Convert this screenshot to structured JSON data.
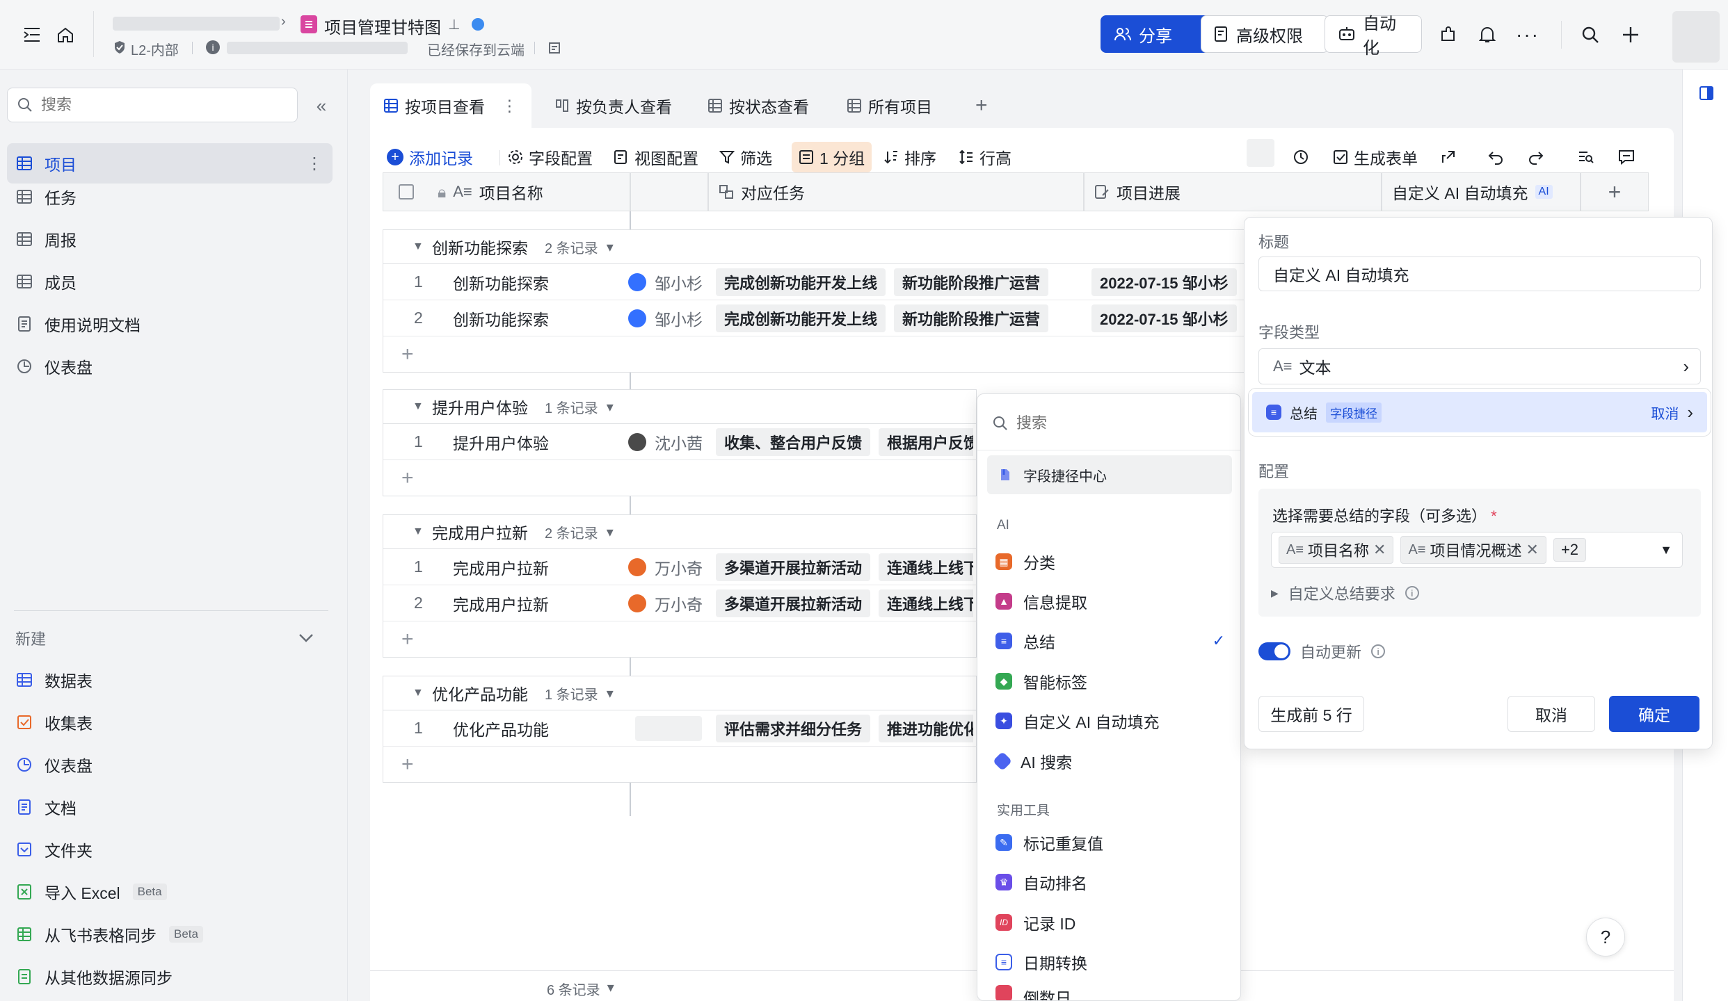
{
  "topbar": {
    "doc_title": "项目管理甘特图",
    "security_label": "L2-内部",
    "save_status": "已经保存到云端",
    "share_label": "分享",
    "advanced_perm_label": "高级权限",
    "automation_label": "自动化"
  },
  "sidebar": {
    "search_placeholder": "搜索",
    "tables": [
      {
        "label": "项目",
        "icon": "grid-table-icon"
      },
      {
        "label": "任务",
        "icon": "grid-table-icon"
      },
      {
        "label": "周报",
        "icon": "grid-table-icon"
      },
      {
        "label": "成员",
        "icon": "grid-table-icon"
      },
      {
        "label": "使用说明文档",
        "icon": "doc-icon"
      },
      {
        "label": "仪表盘",
        "icon": "dashboard-icon"
      }
    ],
    "new_section_label": "新建",
    "new_items": [
      {
        "label": "数据表",
        "icon": "grid-table-icon",
        "beta": ""
      },
      {
        "label": "收集表",
        "icon": "form-icon",
        "beta": ""
      },
      {
        "label": "仪表盘",
        "icon": "dashboard-icon",
        "beta": ""
      },
      {
        "label": "文档",
        "icon": "doc-icon",
        "beta": ""
      },
      {
        "label": "文件夹",
        "icon": "folder-icon",
        "beta": ""
      },
      {
        "label": "导入 Excel",
        "icon": "excel-icon",
        "beta": "Beta"
      },
      {
        "label": "从飞书表格同步",
        "icon": "sheet-sync-icon",
        "beta": "Beta"
      },
      {
        "label": "从其他数据源同步",
        "icon": "datasource-sync-icon",
        "beta": ""
      }
    ]
  },
  "views": {
    "tabs": [
      "按项目查看",
      "按负责人查看",
      "按状态查看",
      "所有项目"
    ]
  },
  "toolbar": {
    "add_record": "添加记录",
    "field_config": "字段配置",
    "view_config": "视图配置",
    "filter": "筛选",
    "group": "1 分组",
    "sort": "排序",
    "row_height": "行高",
    "generate_form": "生成表单"
  },
  "table": {
    "columns": [
      "项目名称",
      "对应任务",
      "项目进展",
      "自定义 AI 自动填充"
    ],
    "ai_badge": "AI",
    "groups": [
      {
        "name": "创新功能探索",
        "count": "2 条记录",
        "rows": [
          {
            "index": "1",
            "name": "创新功能探索",
            "owner": "邹小杉",
            "tasks": [
              "完成创新功能开发上线",
              "新功能阶段推广运营"
            ],
            "progress": "2022-07-15 邹小杉"
          },
          {
            "index": "2",
            "name": "创新功能探索",
            "owner": "邹小杉",
            "tasks": [
              "完成创新功能开发上线",
              "新功能阶段推广运营"
            ],
            "progress": "2022-07-15 邹小杉"
          }
        ]
      },
      {
        "name": "提升用户体验",
        "count": "1 条记录",
        "rows": [
          {
            "index": "1",
            "name": "提升用户体验",
            "owner": "沈小茜",
            "tasks": [
              "收集、整合用户反馈",
              "根据用户反馈"
            ],
            "progress": ""
          }
        ]
      },
      {
        "name": "完成用户拉新",
        "count": "2 条记录",
        "rows": [
          {
            "index": "1",
            "name": "完成用户拉新",
            "owner": "万小奇",
            "tasks": [
              "多渠道开展拉新活动",
              "连通线上线下"
            ],
            "progress": ""
          },
          {
            "index": "2",
            "name": "完成用户拉新",
            "owner": "万小奇",
            "tasks": [
              "多渠道开展拉新活动",
              "连通线上线下"
            ],
            "progress": ""
          }
        ]
      },
      {
        "name": "优化产品功能",
        "count": "1 条记录",
        "rows": [
          {
            "index": "1",
            "name": "优化产品功能",
            "owner": "",
            "tasks": [
              "评估需求并细分任务",
              "推进功能优化"
            ],
            "progress": ""
          }
        ]
      }
    ],
    "footer_count": "6 条记录"
  },
  "dropdown": {
    "search_placeholder": "搜索",
    "shortcut_center": "字段捷径中心",
    "ai_section": "AI",
    "ai_items": [
      {
        "label": "分类",
        "icon": "classify-icon",
        "color": "#e8692a"
      },
      {
        "label": "信息提取",
        "icon": "extract-icon",
        "color": "#c43c8a"
      },
      {
        "label": "总结",
        "icon": "summary-icon",
        "color": "#3f5ee8",
        "checked": true
      },
      {
        "label": "智能标签",
        "icon": "smart-tag-icon",
        "color": "#34a853"
      },
      {
        "label": "自定义 AI 自动填充",
        "icon": "ai-autofill-icon",
        "color": "#3a4ee0"
      },
      {
        "label": "AI 搜索",
        "icon": "ai-search-icon",
        "color": "#4b63f0"
      }
    ],
    "tools_section": "实用工具",
    "tool_items": [
      {
        "label": "标记重复值",
        "icon": "mark-duplicate-icon",
        "color": "#3b6cf0"
      },
      {
        "label": "自动排名",
        "icon": "auto-rank-icon",
        "color": "#6a4ee8"
      },
      {
        "label": "记录 ID",
        "icon": "record-id-icon",
        "color": "#e0445c"
      },
      {
        "label": "日期转换",
        "icon": "date-convert-icon",
        "color": "#3b5ee8"
      },
      {
        "label": "倒数日",
        "icon": "countdown-icon",
        "color": "#e0445c"
      }
    ]
  },
  "panel": {
    "title_label": "标题",
    "title_value": "自定义 AI 自动填充",
    "type_label": "字段类型",
    "type_value": "文本",
    "shortcut_name": "总结",
    "shortcut_badge": "字段捷径",
    "shortcut_cancel": "取消",
    "config_label": "配置",
    "select_fields_label": "选择需要总结的字段（可多选）",
    "required_mark": "*",
    "selected_fields": [
      "项目名称",
      "项目情况概述"
    ],
    "more_count": "+2",
    "custom_req": "自定义总结要求",
    "auto_update": "自动更新",
    "auto_update_on": true,
    "gen_first": "生成前 5 行",
    "cancel": "取消",
    "confirm": "确定",
    "accent": "#1b4ed6"
  }
}
